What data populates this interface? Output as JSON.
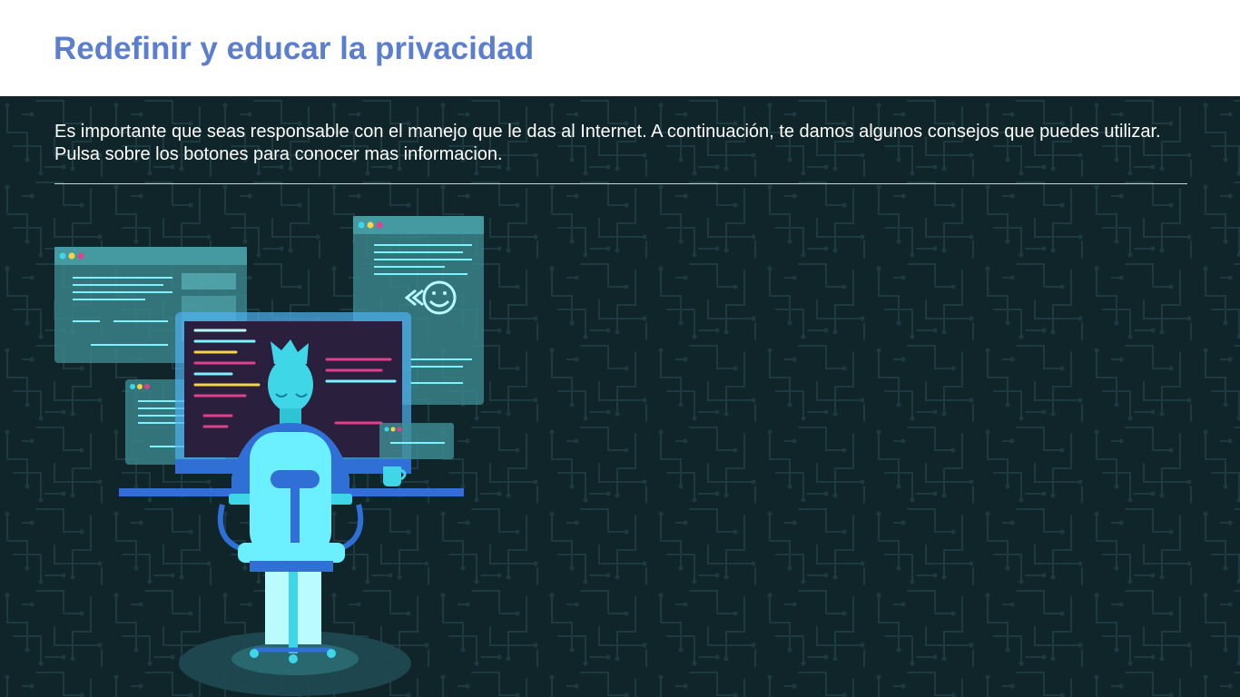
{
  "header": {
    "title": "Redefinir y educar la privacidad"
  },
  "main": {
    "intro": "Es importante que seas responsable con el manejo que le das al Internet. A continuación, te damos algunos consejos que puedes utilizar. Pulsa sobre los botones para conocer mas informacion.",
    "illustration": {
      "icon": "person-at-computer-illustration"
    }
  },
  "colors": {
    "title": "#5b7fce",
    "background": "#10252a",
    "accent_cyan": "#3fd6e8",
    "accent_blue": "#2f6fd6",
    "accent_pink": "#e0418c"
  }
}
